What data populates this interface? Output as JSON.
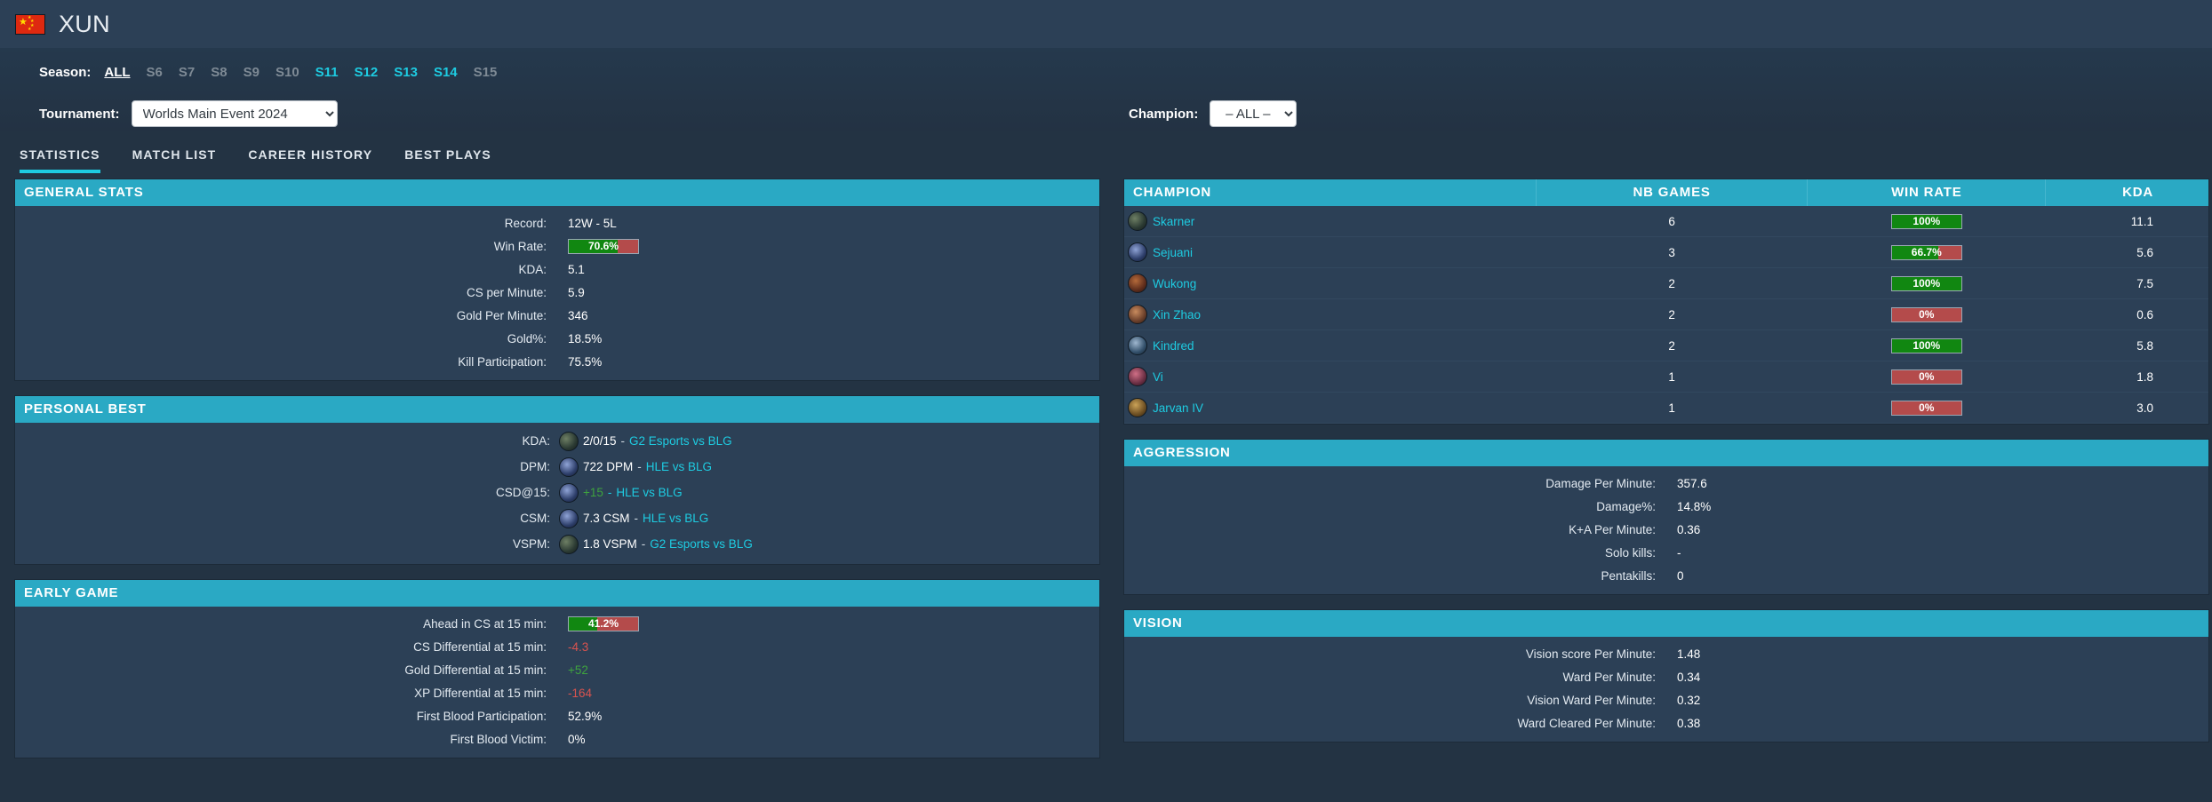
{
  "player": {
    "name": "XUN",
    "flag": "china-flag",
    "flag_color": "#de2910"
  },
  "filters": {
    "season_label": "Season:",
    "seasons": [
      {
        "label": "ALL",
        "state": "active"
      },
      {
        "label": "S6",
        "state": "dim"
      },
      {
        "label": "S7",
        "state": "dim"
      },
      {
        "label": "S8",
        "state": "dim"
      },
      {
        "label": "S9",
        "state": "dim"
      },
      {
        "label": "S10",
        "state": "dim"
      },
      {
        "label": "S11",
        "state": "hl"
      },
      {
        "label": "S12",
        "state": "hl"
      },
      {
        "label": "S13",
        "state": "hl"
      },
      {
        "label": "S14",
        "state": "hl"
      },
      {
        "label": "S15",
        "state": "dim"
      }
    ],
    "tournament_label": "Tournament:",
    "tournament_value": "Worlds Main Event 2024",
    "champion_label": "Champion:",
    "champion_value": "– ALL –"
  },
  "tabs": [
    {
      "label": "STATISTICS",
      "active": true
    },
    {
      "label": "MATCH LIST",
      "active": false
    },
    {
      "label": "CAREER HISTORY",
      "active": false
    },
    {
      "label": "BEST PLAYS",
      "active": false
    }
  ],
  "general_stats": {
    "title": "GENERAL STATS",
    "rows": [
      {
        "label": "Record:",
        "value": "12W - 5L",
        "type": "text"
      },
      {
        "label": "Win Rate:",
        "value": "70.6%",
        "type": "bar",
        "pct": 70.6
      },
      {
        "label": "KDA:",
        "value": "5.1",
        "type": "text"
      },
      {
        "label": "CS per Minute:",
        "value": "5.9",
        "type": "text"
      },
      {
        "label": "Gold Per Minute:",
        "value": "346",
        "type": "text"
      },
      {
        "label": "Gold%:",
        "value": "18.5%",
        "type": "text"
      },
      {
        "label": "Kill Participation:",
        "value": "75.5%",
        "type": "text"
      }
    ]
  },
  "personal_best": {
    "title": "PERSONAL BEST",
    "rows": [
      {
        "label": "KDA:",
        "champ": "skarner",
        "value": "2/0/15",
        "value_color": "white",
        "dash": "-",
        "match": "G2 Esports vs BLG"
      },
      {
        "label": "DPM:",
        "champ": "sejuani",
        "value": "722 DPM",
        "value_color": "white",
        "dash": "-",
        "match": "HLE vs BLG"
      },
      {
        "label": "CSD@15:",
        "champ": "sejuani",
        "value": "+15",
        "value_color": "green",
        "dash": "-",
        "match": "HLE vs BLG"
      },
      {
        "label": "CSM:",
        "champ": "sejuani",
        "value": "7.3 CSM",
        "value_color": "white",
        "dash": "-",
        "match": "HLE vs BLG"
      },
      {
        "label": "VSPM:",
        "champ": "skarner",
        "value": "1.8 VSPM",
        "value_color": "white",
        "dash": "-",
        "match": "G2 Esports vs BLG"
      }
    ]
  },
  "early_game": {
    "title": "EARLY GAME",
    "rows": [
      {
        "label": "Ahead in CS at 15 min:",
        "value": "41.2%",
        "type": "bar",
        "pct": 41.2
      },
      {
        "label": "CS Differential at 15 min:",
        "value": "-4.3",
        "type": "neg"
      },
      {
        "label": "Gold Differential at 15 min:",
        "value": "+52",
        "type": "pos"
      },
      {
        "label": "XP Differential at 15 min:",
        "value": "-164",
        "type": "neg"
      },
      {
        "label": "First Blood Participation:",
        "value": "52.9%",
        "type": "text"
      },
      {
        "label": "First Blood Victim:",
        "value": "0%",
        "type": "text"
      }
    ]
  },
  "champion_table": {
    "headers": [
      "CHAMPION",
      "NB GAMES",
      "WIN RATE",
      "KDA"
    ],
    "rows": [
      {
        "champion": "Skarner",
        "icon": "skarner",
        "games": "6",
        "winrate": "100%",
        "pct": 100,
        "kda": "11.1"
      },
      {
        "champion": "Sejuani",
        "icon": "sejuani",
        "games": "3",
        "winrate": "66.7%",
        "pct": 66.7,
        "kda": "5.6"
      },
      {
        "champion": "Wukong",
        "icon": "wukong",
        "games": "2",
        "winrate": "100%",
        "pct": 100,
        "kda": "7.5"
      },
      {
        "champion": "Xin Zhao",
        "icon": "xinzhao",
        "games": "2",
        "winrate": "0%",
        "pct": 0,
        "kda": "0.6"
      },
      {
        "champion": "Kindred",
        "icon": "kindred",
        "games": "2",
        "winrate": "100%",
        "pct": 100,
        "kda": "5.8"
      },
      {
        "champion": "Vi",
        "icon": "vi",
        "games": "1",
        "winrate": "0%",
        "pct": 0,
        "kda": "1.8"
      },
      {
        "champion": "Jarvan IV",
        "icon": "jarvan",
        "games": "1",
        "winrate": "0%",
        "pct": 0,
        "kda": "3.0"
      }
    ]
  },
  "aggression": {
    "title": "AGGRESSION",
    "rows": [
      {
        "label": "Damage Per Minute:",
        "value": "357.6"
      },
      {
        "label": "Damage%:",
        "value": "14.8%"
      },
      {
        "label": "K+A Per Minute:",
        "value": "0.36"
      },
      {
        "label": "Solo kills:",
        "value": "-"
      },
      {
        "label": "Pentakills:",
        "value": "0"
      }
    ]
  },
  "vision": {
    "title": "VISION",
    "rows": [
      {
        "label": "Vision score Per Minute:",
        "value": "1.48"
      },
      {
        "label": "Ward Per Minute:",
        "value": "0.34"
      },
      {
        "label": "Vision Ward Per Minute:",
        "value": "0.32"
      },
      {
        "label": "Ward Cleared Per Minute:",
        "value": "0.38"
      }
    ]
  },
  "colors": {
    "accent": "#1ecbe1",
    "panel_header": "#2aa9c4",
    "panel_bg": "#2c4056",
    "page_bg": "#233343",
    "win_green": "#118711",
    "loss_red": "#b44b4b",
    "positive": "#3ea33e",
    "negative": "#d9534f"
  }
}
